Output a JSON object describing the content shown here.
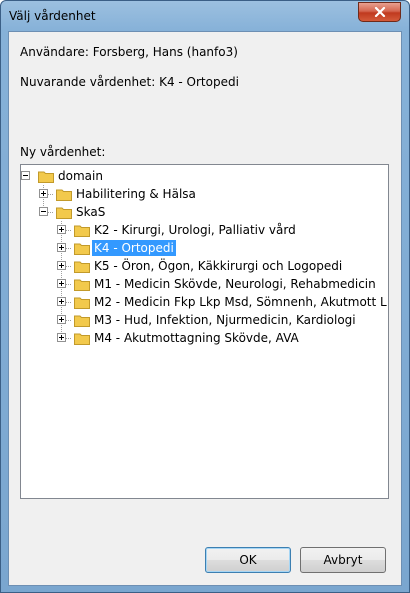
{
  "window": {
    "title": "Välj vårdenhet",
    "close_label": "Close"
  },
  "info": {
    "user_label": "Användare: Forsberg, Hans (hanfo3)",
    "current_unit_label": "Nuvarande vårdenhet: K4 - Ortopedi",
    "new_unit_label": "Ny vårdenhet:"
  },
  "tree": {
    "root": "domain",
    "items": [
      {
        "label": "Habilitering & Hälsa",
        "expander": "plus"
      },
      {
        "label": "SkaS",
        "expander": "minus"
      },
      {
        "label": "K2 - Kirurgi, Urologi, Palliativ vård",
        "expander": "plus"
      },
      {
        "label": "K4 - Ortopedi",
        "expander": "plus",
        "selected": true
      },
      {
        "label": "K5 - Öron, Ögon, Käkkirurgi och Logopedi",
        "expander": "plus"
      },
      {
        "label": "M1 - Medicin Skövde, Neurologi, Rehabmedicin",
        "expander": "plus"
      },
      {
        "label": "M2 - Medicin Fkp Lkp Msd, Sömnenh, Akutmott L",
        "expander": "plus"
      },
      {
        "label": "M3 - Hud, Infektion, Njurmedicin, Kardiologi",
        "expander": "plus"
      },
      {
        "label": "M4 - Akutmottagning Skövde, AVA",
        "expander": "plus"
      }
    ]
  },
  "buttons": {
    "ok": "OK",
    "cancel": "Avbryt"
  },
  "colors": {
    "selection": "#3399ff",
    "folder": "#f2c94c"
  }
}
